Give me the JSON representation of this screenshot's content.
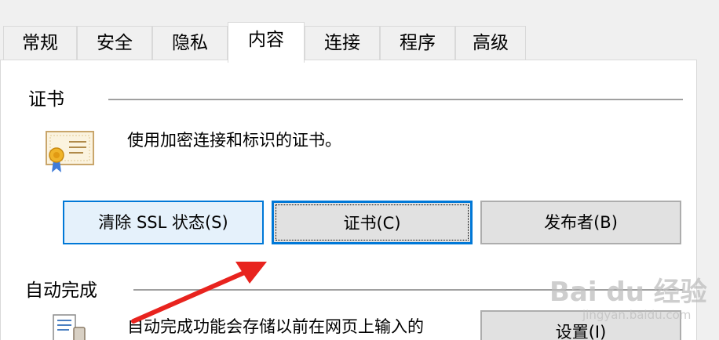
{
  "tabs": [
    {
      "label": "常规"
    },
    {
      "label": "安全"
    },
    {
      "label": "隐私"
    },
    {
      "label": "内容",
      "active": true
    },
    {
      "label": "连接"
    },
    {
      "label": "程序"
    },
    {
      "label": "高级"
    }
  ],
  "certificates": {
    "group_label": "证书",
    "description": "使用加密连接和标识的证书。",
    "clear_ssl_label": "清除 SSL 状态(S)",
    "certificates_label": "证书(C)",
    "publishers_label": "发布者(B)"
  },
  "autocomplete": {
    "group_label": "自动完成",
    "description": "自动完成功能会存储以前在网页上输入的",
    "settings_label": "设置(I)"
  },
  "watermark": {
    "text": "Bai du 经验",
    "url": "jingyan.baidu.com"
  },
  "colors": {
    "accent": "#0078d7",
    "hover_bg": "#e5f1fb",
    "arrow": "#e8231e"
  }
}
